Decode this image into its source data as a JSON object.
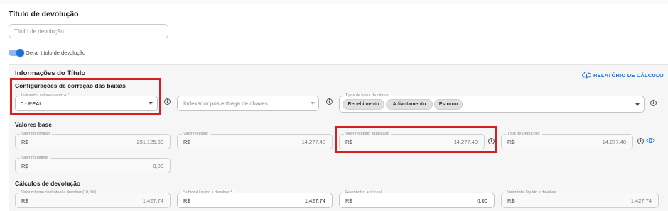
{
  "return_title": {
    "heading": "Título de devolução",
    "input_placeholder": "Título de devolução",
    "toggle_label": "Gerar título de devolução",
    "toggle_on": true
  },
  "title_info": {
    "heading": "Informações do Título",
    "report_link": "RELATÓRIO DE CÁLCULO",
    "correction_config": {
      "heading": "Configurações de correção das baixas",
      "indexer_label": "Indexador valores neutros *",
      "indexer_value": "0 - REAL",
      "post_delivery_placeholder": "Indexador pós entrega de chaves",
      "writeoff_types_label": "Tipos de baixa do cálculo",
      "writeoff_types": [
        "Recebimento",
        "Adiantamento",
        "Estorno"
      ]
    },
    "base_values": {
      "heading": "Valores base",
      "currency": "R$",
      "fields": [
        {
          "label": "Valor do contrato",
          "value": "291.125,80"
        },
        {
          "label": "Valor recebido",
          "value": "14.277,40"
        },
        {
          "label": "Valor recebido atualizado",
          "value": "14.277,40"
        },
        {
          "label": "Total de Deduções",
          "value": "14.277,40"
        },
        {
          "label": "Valor resultante",
          "value": "0,00"
        }
      ]
    },
    "return_calc": {
      "heading": "Cálculos de devolução",
      "currency": "R$",
      "fields": [
        {
          "label": "Valor mínimo contratual a devolver (10,0%)",
          "value": "1.427,74"
        },
        {
          "label": "Subtotal líquido a devolver *",
          "value": "1.427,74"
        },
        {
          "label": "Reembolso adicional",
          "value": "0,00"
        },
        {
          "label": "Valor total líquido a devolver",
          "value": "1.427,74"
        }
      ]
    }
  },
  "colors": {
    "accent": "#1e6fd9",
    "highlight_box": "#d21f1f"
  }
}
